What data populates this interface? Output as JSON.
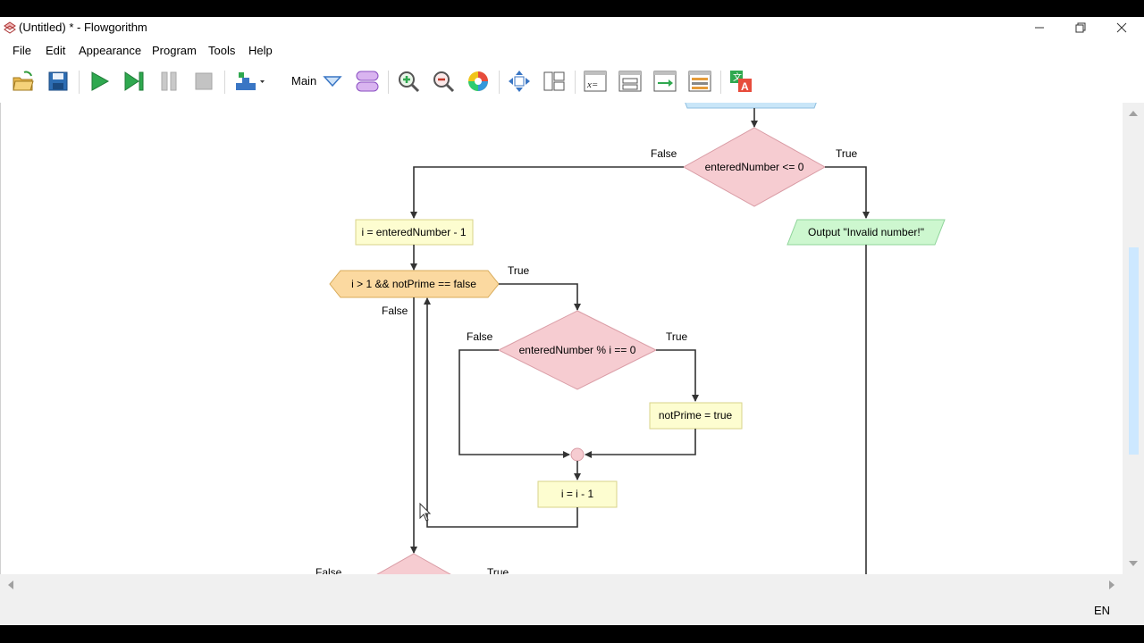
{
  "window": {
    "title": "(Untitled) * - Flowgorithm",
    "controls": [
      "minimize-icon",
      "restore-icon",
      "close-icon"
    ]
  },
  "menu": [
    "File",
    "Edit",
    "Appearance",
    "Program",
    "Tools",
    "Help"
  ],
  "toolbar": {
    "function_label": "Main",
    "buttons": [
      "open-icon",
      "save-icon",
      "run-icon",
      "step-icon",
      "pause-icon",
      "stop-icon",
      "layout-icon",
      "function-dropdown-icon",
      "manage-functions-icon",
      "zoom-in-icon",
      "zoom-out-icon",
      "color-theme-icon",
      "fit-icon",
      "windows-icon",
      "variable-watch-icon",
      "console-icon",
      "output-icon",
      "source-view-icon",
      "translate-icon"
    ]
  },
  "flowchart": {
    "decision1": "enteredNumber <= 0",
    "decision1_false": "False",
    "decision1_true": "True",
    "assign1": "i = enteredNumber - 1",
    "output1": "Output \"Invalid number!\"",
    "loop": "i > 1 && notPrime == false",
    "loop_true": "True",
    "loop_false": "False",
    "decision2": "enteredNumber % i == 0",
    "decision2_false": "False",
    "decision2_true": "True",
    "assign2": "notPrime = true",
    "assign3": "i = i - 1",
    "decision3_false": "False",
    "decision3_true": "True"
  },
  "status": {
    "language": "EN"
  },
  "colors": {
    "decision_fill": "#f6ccd1",
    "assign_fill": "#fdfdd0",
    "loop_fill": "#fbd9a0",
    "output_fill": "#cdf7cf",
    "input_fill": "#c9e6f8",
    "scroll_thumb": "#cde8ff"
  }
}
